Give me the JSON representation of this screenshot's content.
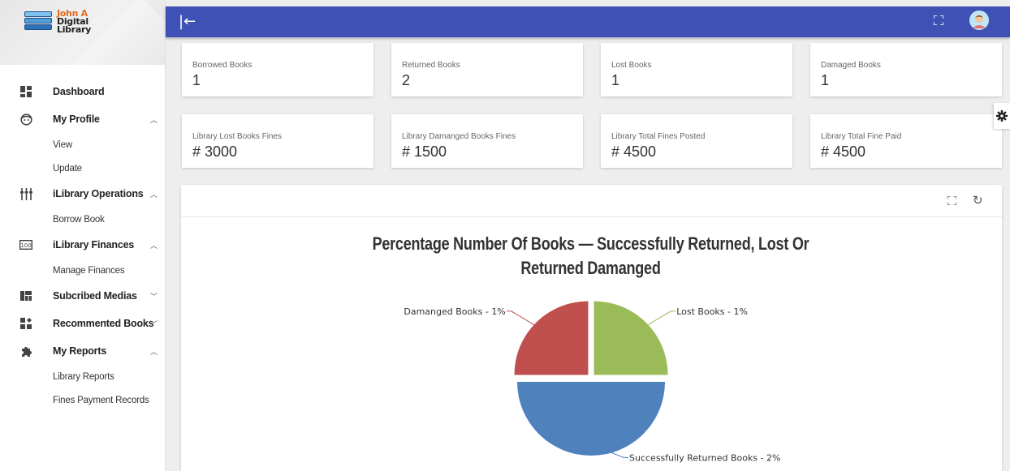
{
  "brand": {
    "line1": "John A",
    "line2": "Digital",
    "line3": "Library"
  },
  "sidebar": {
    "items": [
      {
        "label": "Dashboard",
        "icon": "dashboard-icon",
        "chevron": ""
      },
      {
        "label": "My Profile",
        "icon": "face-icon",
        "chevron": "^",
        "sub": [
          "View",
          "Update"
        ]
      },
      {
        "label": "iLibrary Operations",
        "icon": "tune-icon",
        "chevron": "^",
        "sub": [
          "Borrow Book"
        ]
      },
      {
        "label": "iLibrary Finances",
        "icon": "counter-icon",
        "chevron": "^",
        "sub": [
          "Manage Finances"
        ]
      },
      {
        "label": "Subcribed Medias",
        "icon": "view-quilt-icon",
        "chevron": "v"
      },
      {
        "label": "Recommented Books",
        "icon": "widgets-icon",
        "chevron": "v"
      },
      {
        "label": "My Reports",
        "icon": "extension-icon",
        "chevron": "^",
        "sub": [
          "Library Reports",
          "Fines Payment Records"
        ]
      }
    ]
  },
  "topbar": {
    "toggle_glyph": "|←",
    "color": "#3f51b5"
  },
  "stats_row1": [
    {
      "title": "Borrowed Books",
      "value": "1"
    },
    {
      "title": "Returned Books",
      "value": "2"
    },
    {
      "title": "Lost Books",
      "value": "1"
    },
    {
      "title": "Damaged Books",
      "value": "1"
    }
  ],
  "stats_row2": [
    {
      "title": "Library Lost Books Fines",
      "value": "# 3000"
    },
    {
      "title": "Library Damanged Books Fines",
      "value": "# 1500"
    },
    {
      "title": "Library Total Fines Posted",
      "value": "# 4500"
    },
    {
      "title": "Library Total Fine Paid",
      "value": "# 4500"
    }
  ],
  "chart_data": {
    "type": "pie",
    "title_line1": "Percentage Number Of Books — Successfully Returned, Lost Or",
    "title_line2": "Returned Damanged",
    "slices": [
      {
        "label": "Lost Books - 1%",
        "value": 1,
        "color": "#9bbb59"
      },
      {
        "label": "Successfully Returned Books - 2%",
        "value": 2,
        "color": "#4f81bd"
      },
      {
        "label": "Damanged Books - 1%",
        "value": 1,
        "color": "#c0504d"
      }
    ],
    "exploded": true
  }
}
